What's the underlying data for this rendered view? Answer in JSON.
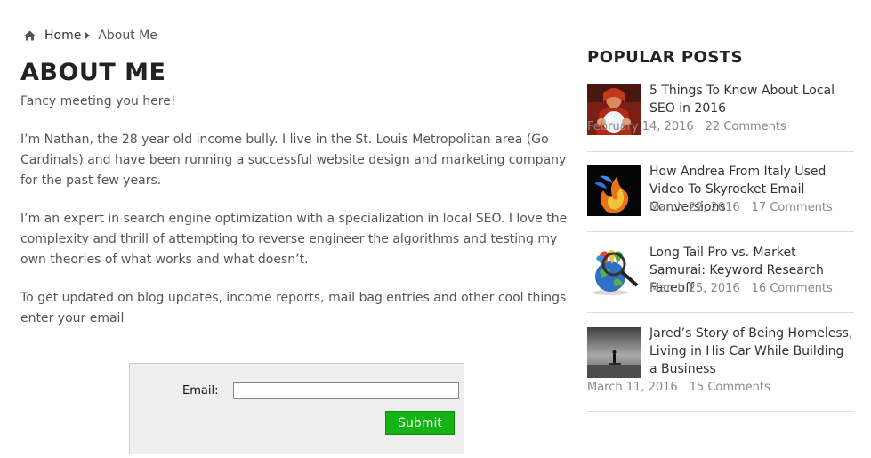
{
  "breadcrumb": {
    "home_label": "Home",
    "current_label": "About Me"
  },
  "page": {
    "title": "ABOUT ME",
    "paragraphs": [
      "Fancy meeting you here!",
      "I’m Nathan, the 28 year old income bully. I live in the St. Louis Metropolitan area (Go Cardinals) and have been running a successful website design and marketing company for the past few years.",
      "I’m an expert in search engine optimization with a specialization in local SEO. I love the complexity and thrill of attempting to reverse engineer the algorithms and testing my own theories of what works and what doesn’t.",
      "To get updated on blog updates, income reports, mail bag entries and other cool things enter your email"
    ]
  },
  "subscribe": {
    "email_label": "Email:",
    "email_value": "",
    "submit_label": "Submit"
  },
  "sidebar": {
    "heading": "POPULAR POSTS",
    "posts": [
      {
        "title": "5 Things To Know About Local SEO in 2016",
        "date": "February 14, 2016",
        "comments": "22 Comments",
        "icon": "crystal-ball-thumbnail"
      },
      {
        "title": "How Andrea From Italy Used Video To Skyrocket Email Conversions",
        "date": "March 22, 2016",
        "comments": "17 Comments",
        "icon": "fire-thumbnail"
      },
      {
        "title": "Long Tail Pro vs. Market Samurai: Keyword Research Faceoff",
        "date": "March 25, 2016",
        "comments": "16 Comments",
        "icon": "globe-magnifier-thumbnail"
      },
      {
        "title": "Jared’s Story of Being Homeless, Living in His Car While Building a Business",
        "date": "March 11, 2016",
        "comments": "15 Comments",
        "icon": "lonely-figure-thumbnail"
      }
    ]
  },
  "colors": {
    "submit_green": "#16b316",
    "text_gray": "#555555",
    "heading_dark": "#222222"
  }
}
